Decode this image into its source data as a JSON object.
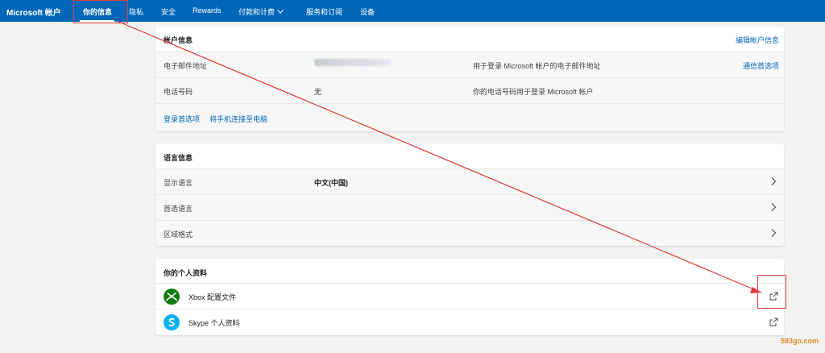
{
  "topbar": {
    "brand": "Microsoft 帐户",
    "nav": [
      {
        "label": "你的信息"
      },
      {
        "label": "隐私"
      },
      {
        "label": "安全"
      },
      {
        "label": "Rewards"
      },
      {
        "label": "付款和计费"
      },
      {
        "label": "服务和订阅"
      },
      {
        "label": "设备"
      }
    ]
  },
  "account_info": {
    "title": "帐户信息",
    "edit_link": "编辑帐户信息",
    "rows": [
      {
        "label": "电子邮件地址",
        "value": "",
        "desc": "用于登录 Microsoft 帐户的电子邮件地址",
        "action": "通信首选项"
      },
      {
        "label": "电话号码",
        "value": "无",
        "desc": "你的电话号码用于登录 Microsoft 帐户",
        "action": ""
      }
    ],
    "footer_links": [
      "登录首选项",
      "将手机连接至电脑"
    ]
  },
  "language_info": {
    "title": "语言信息",
    "rows": [
      {
        "label": "显示语言",
        "value": "中文(中国)"
      },
      {
        "label": "首选语言",
        "value": ""
      },
      {
        "label": "区域格式",
        "value": ""
      }
    ]
  },
  "profile": {
    "title": "你的个人资料",
    "rows": [
      {
        "label": "Xbox 配置文件",
        "icon": "xbox-icon"
      },
      {
        "label": "Skype 个人资料",
        "icon": "skype-icon"
      }
    ]
  },
  "watermark": "583go.com",
  "colors": {
    "topbar": "#0067b8",
    "link": "#0067b8",
    "xbox": "#107c10",
    "skype": "#00aff0",
    "annotation": "#e03b3b"
  }
}
